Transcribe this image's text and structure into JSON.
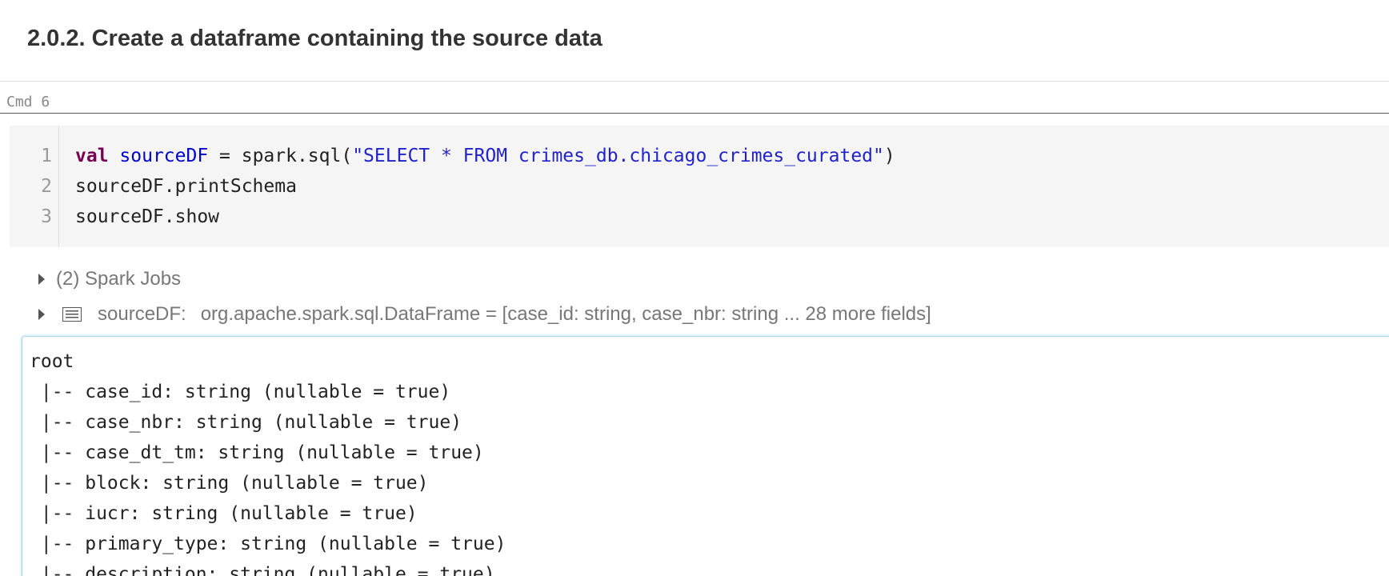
{
  "markdown_cell": {
    "heading": "2.0.2. Create a dataframe containing the source data"
  },
  "command": {
    "label": "Cmd 6"
  },
  "code": {
    "lines": [
      {
        "number": "1",
        "keyword": "val",
        "variable": "sourceDF",
        "assign": " = spark.sql(",
        "string": "\"SELECT * FROM crimes_db.chicago_crimes_curated\"",
        "close": ")"
      },
      {
        "number": "2",
        "text": "sourceDF.printSchema"
      },
      {
        "number": "3",
        "text": "sourceDF.show"
      }
    ]
  },
  "results": {
    "spark_jobs": "(2) Spark Jobs",
    "dataframe": {
      "name": "sourceDF:",
      "type": "org.apache.spark.sql.DataFrame = [case_id: string, case_nbr: string ... 28 more fields]",
      "icon": "table-icon"
    }
  },
  "output": {
    "lines": [
      "root",
      " |-- case_id: string (nullable = true)",
      " |-- case_nbr: string (nullable = true)",
      " |-- case_dt_tm: string (nullable = true)",
      " |-- block: string (nullable = true)",
      " |-- iucr: string (nullable = true)",
      " |-- primary_type: string (nullable = true)",
      " |-- description: string (nullable = true)"
    ]
  },
  "colors": {
    "keyword": "#770055",
    "variable": "#0000cc",
    "string": "#2222cc",
    "output_border": "#a8d8ee"
  }
}
